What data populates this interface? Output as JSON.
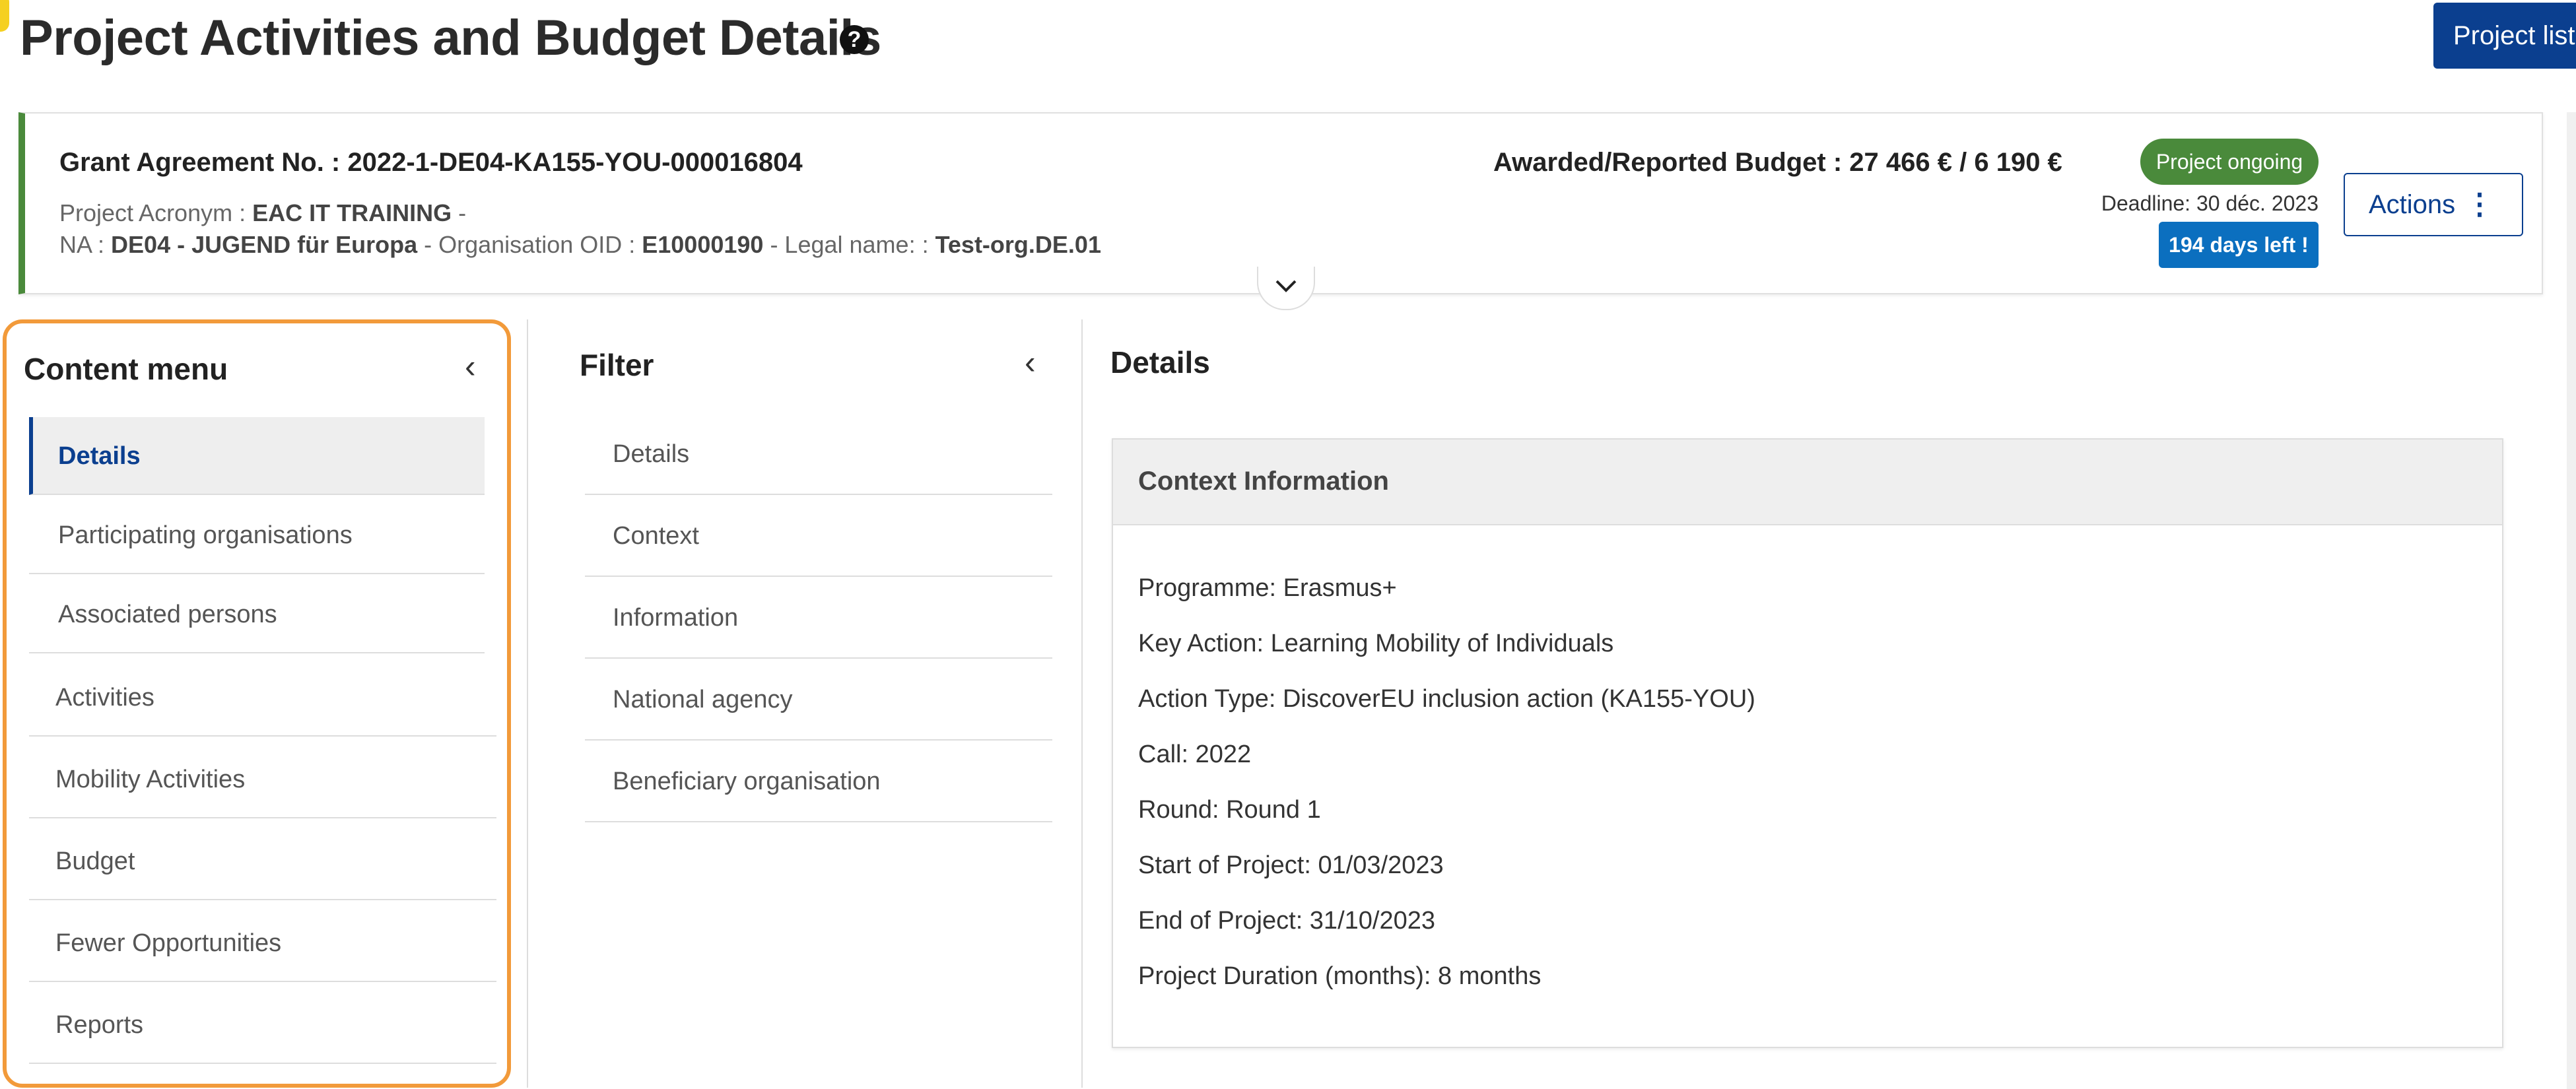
{
  "page": {
    "title": "Project Activities and Budget Details",
    "help_icon": "?"
  },
  "top_button": {
    "label": "Project list"
  },
  "summary": {
    "ga_label": "Grant Agreement No. : ",
    "ga_value": "2022-1-DE04-KA155-YOU-000016804",
    "acronym_label": "Project Acronym : ",
    "acronym_value": "EAC IT TRAINING",
    "acronym_suffix": " -",
    "na_label": "NA : ",
    "na_value": "DE04 - JUGEND für Europa",
    "oid_label": " - Organisation OID : ",
    "oid_value": "E10000190",
    "legal_label": " - Legal name: : ",
    "legal_value": "Test-org.DE.01",
    "budget_label": "Awarded/Reported Budget : ",
    "budget_value": "27 466 € / 6 190 €",
    "status": "Project ongoing",
    "deadline": "Deadline: 30 déc. 2023",
    "days_left": "194 days left !",
    "actions_label": "Actions",
    "status_color": "#4a8a3b"
  },
  "content_menu": {
    "title": "Content menu",
    "items": [
      {
        "label": "Details"
      },
      {
        "label": "Participating organisations"
      },
      {
        "label": "Associated persons"
      },
      {
        "label": "Activities"
      },
      {
        "label": "Mobility Activities"
      },
      {
        "label": "Budget"
      },
      {
        "label": "Fewer Opportunities"
      },
      {
        "label": "Reports"
      }
    ]
  },
  "filter": {
    "title": "Filter",
    "items": [
      {
        "label": "Details"
      },
      {
        "label": "Context"
      },
      {
        "label": "Information"
      },
      {
        "label": "National agency"
      },
      {
        "label": "Beneficiary organisation"
      }
    ]
  },
  "details": {
    "title": "Details",
    "section_title": "Context Information",
    "lines": [
      "Programme: Erasmus+",
      "Key Action: Learning Mobility of Individuals",
      "Action Type: DiscoverEU inclusion action (KA155-YOU)",
      "Call: 2022",
      "Round: Round 1",
      "Start of Project: 01/03/2023",
      "End of Project: 31/10/2023",
      "Project Duration (months): 8 months"
    ]
  }
}
